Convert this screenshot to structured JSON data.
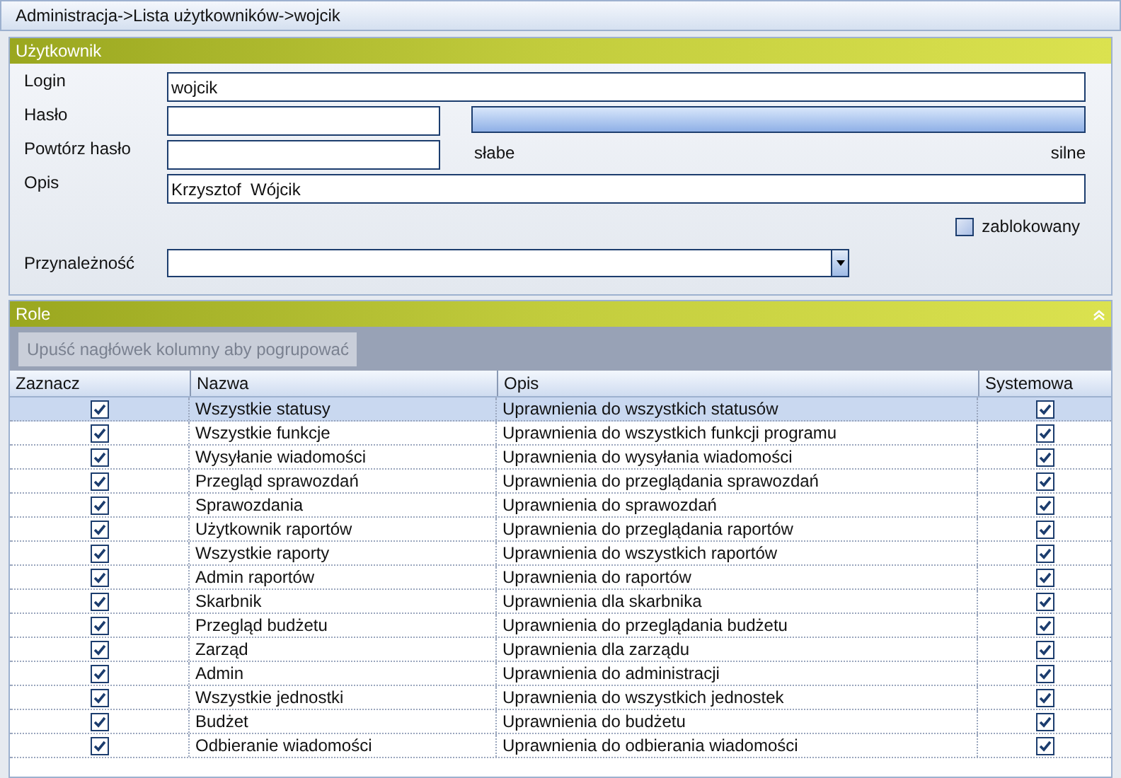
{
  "window": {
    "title": "Administracja->Lista użytkowników->wojcik"
  },
  "user_section": {
    "title": "Użytkownik",
    "fields": [
      {
        "label": "Login",
        "value": "wojcik",
        "kind": "wide"
      },
      {
        "label": "Hasło",
        "kind": "password"
      },
      {
        "label": "Powtórz hasło",
        "kind": "repeat"
      },
      {
        "label": "Opis",
        "value": "Krzysztof  Wójcik",
        "kind": "wide"
      }
    ],
    "strength": {
      "weak": "słabe",
      "strong": "silne"
    },
    "blocked": {
      "label": "zablokowany",
      "checked": false
    },
    "membership": {
      "label": "Przynależność"
    }
  },
  "roles_section": {
    "title": "Role",
    "group_hint": "Upuść nagłówek kolumny aby pogrupować",
    "columns": [
      "Zaznacz",
      "Nazwa",
      "Opis",
      "Systemowa"
    ],
    "rows": [
      {
        "checked": true,
        "name": "Wszystkie statusy",
        "description": "Uprawnienia do wszystkich statusów",
        "system": true,
        "selected": true
      },
      {
        "checked": true,
        "name": "Wszystkie funkcje",
        "description": "Uprawnienia do wszystkich funkcji programu",
        "system": true,
        "selected": false
      },
      {
        "checked": true,
        "name": "Wysyłanie wiadomości",
        "description": "Uprawnienia do wysyłania wiadomości",
        "system": true,
        "selected": false
      },
      {
        "checked": true,
        "name": "Przegląd sprawozdań",
        "description": "Uprawnienia do przeglądania sprawozdań",
        "system": true,
        "selected": false
      },
      {
        "checked": true,
        "name": "Sprawozdania",
        "description": "Uprawnienia do sprawozdań",
        "system": true,
        "selected": false
      },
      {
        "checked": true,
        "name": "Użytkownik raportów",
        "description": "Uprawnienia do przeglądania raportów",
        "system": true,
        "selected": false
      },
      {
        "checked": true,
        "name": "Wszystkie raporty",
        "description": "Uprawnienia do wszystkich raportów",
        "system": true,
        "selected": false
      },
      {
        "checked": true,
        "name": "Admin raportów",
        "description": "Uprawnienia do raportów",
        "system": true,
        "selected": false
      },
      {
        "checked": true,
        "name": "Skarbnik",
        "description": "Uprawnienia dla skarbnika",
        "system": true,
        "selected": false
      },
      {
        "checked": true,
        "name": "Przegląd budżetu",
        "description": "Uprawnienia do przeglądania budżetu",
        "system": true,
        "selected": false
      },
      {
        "checked": true,
        "name": "Zarząd",
        "description": "Uprawnienia dla zarządu",
        "system": true,
        "selected": false
      },
      {
        "checked": true,
        "name": "Admin",
        "description": "Uprawnienia do administracji",
        "system": true,
        "selected": false
      },
      {
        "checked": true,
        "name": "Wszystkie jednostki",
        "description": "Uprawnienia do wszystkich jednostek",
        "system": true,
        "selected": false
      },
      {
        "checked": true,
        "name": "Budżet",
        "description": "Uprawnienia do budżetu",
        "system": true,
        "selected": false
      },
      {
        "checked": true,
        "name": "Odbieranie wiadomości",
        "description": "Uprawnienia do odbierania wiadomości",
        "system": true,
        "selected": false
      }
    ]
  }
}
